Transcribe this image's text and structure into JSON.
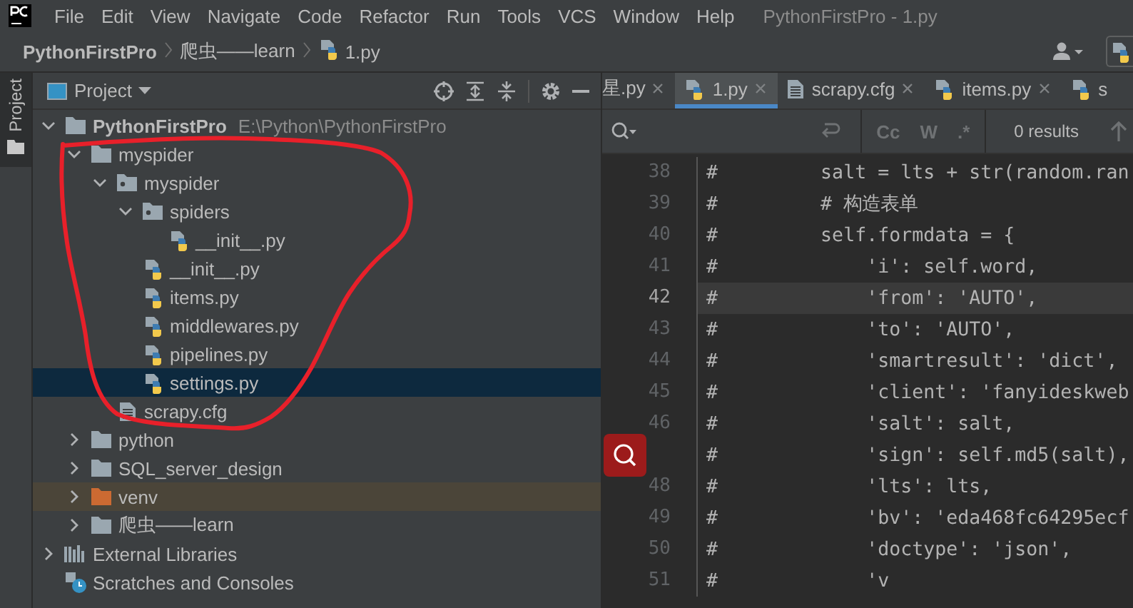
{
  "menu_bar": {
    "items": [
      "File",
      "Edit",
      "View",
      "Navigate",
      "Code",
      "Refactor",
      "Run",
      "Tools",
      "VCS",
      "Window",
      "Help"
    ],
    "title": "PythonFirstPro - 1.py"
  },
  "breadcrumb": [
    {
      "label": "PythonFirstPro",
      "kind": "project"
    },
    {
      "label": "爬虫——learn",
      "kind": "folder"
    },
    {
      "label": "1.py",
      "kind": "python"
    }
  ],
  "tool_strip": {
    "label": "Project",
    "selected": true
  },
  "project_panel": {
    "title": "Project",
    "tree": [
      {
        "name": "PythonFirstPro",
        "path": "E:\\Python\\PythonFirstPro",
        "kind": "folder",
        "expanded": true,
        "selected": false,
        "children": [
          {
            "name": "myspider",
            "kind": "folder",
            "expanded": true,
            "selected": false,
            "children": [
              {
                "name": "myspider",
                "kind": "package",
                "expanded": true,
                "selected": false,
                "children": [
                  {
                    "name": "spiders",
                    "kind": "package",
                    "expanded": true,
                    "selected": false,
                    "children": [
                      {
                        "name": "__init__.py",
                        "kind": "python",
                        "selected": false
                      }
                    ]
                  },
                  {
                    "name": "__init__.py",
                    "kind": "python",
                    "selected": false
                  },
                  {
                    "name": "items.py",
                    "kind": "python",
                    "selected": false
                  },
                  {
                    "name": "middlewares.py",
                    "kind": "python",
                    "selected": false
                  },
                  {
                    "name": "pipelines.py",
                    "kind": "python",
                    "selected": false
                  },
                  {
                    "name": "settings.py",
                    "kind": "python",
                    "selected": true
                  }
                ]
              },
              {
                "name": "scrapy.cfg",
                "kind": "text",
                "selected": false
              }
            ]
          },
          {
            "name": "python",
            "kind": "folder",
            "expanded": false,
            "selected": false
          },
          {
            "name": "SQL_server_design",
            "kind": "folder",
            "expanded": false,
            "selected": false
          },
          {
            "name": "venv",
            "kind": "excluded",
            "expanded": false,
            "selected": false
          },
          {
            "name": "爬虫——learn",
            "kind": "folder",
            "expanded": false,
            "selected": false
          }
        ]
      },
      {
        "name": "External Libraries",
        "kind": "libraries",
        "expanded": false,
        "selected": false
      },
      {
        "name": "Scratches and Consoles",
        "kind": "scratches",
        "selected": false
      }
    ]
  },
  "editor": {
    "tabs": [
      {
        "label": "星.py",
        "kind": "python",
        "selected": false,
        "closable": true
      },
      {
        "label": "1.py",
        "kind": "python",
        "selected": true,
        "closable": true
      },
      {
        "label": "scrapy.cfg",
        "kind": "text",
        "selected": false,
        "closable": true
      },
      {
        "label": "items.py",
        "kind": "python",
        "selected": false,
        "closable": true
      },
      {
        "label": "s",
        "kind": "python",
        "selected": false,
        "closable": false
      }
    ],
    "search": {
      "options": [
        "Cc",
        "W",
        ".*"
      ],
      "results": "0 results"
    },
    "lines": [
      {
        "number": "38",
        "text": "#         salt = lts + str(random.ran",
        "current": false
      },
      {
        "number": "39",
        "text": "#         # 构造表单",
        "current": false
      },
      {
        "number": "40",
        "text": "#         self.formdata = {",
        "current": false
      },
      {
        "number": "41",
        "text": "#             'i': self.word,",
        "current": false
      },
      {
        "number": "42",
        "text": "#             'from': 'AUTO',",
        "current": true
      },
      {
        "number": "43",
        "text": "#             'to': 'AUTO',",
        "current": false
      },
      {
        "number": "44",
        "text": "#             'smartresult': 'dict',",
        "current": false
      },
      {
        "number": "45",
        "text": "#             'client': 'fanyideskweb",
        "current": false
      },
      {
        "number": "46",
        "text": "#             'salt': salt,",
        "current": false
      },
      {
        "kind": "search-marker",
        "text": "#             'sign': self.md5(salt),",
        "current": false
      },
      {
        "number": "48",
        "text": "#             'lts': lts,",
        "current": false
      },
      {
        "number": "49",
        "text": "#             'bv': 'eda468fc64295ecf",
        "current": false
      },
      {
        "number": "50",
        "text": "#             'doctype': 'json',",
        "current": false
      },
      {
        "number": "51",
        "text": "#             'v",
        "current": false
      }
    ]
  }
}
